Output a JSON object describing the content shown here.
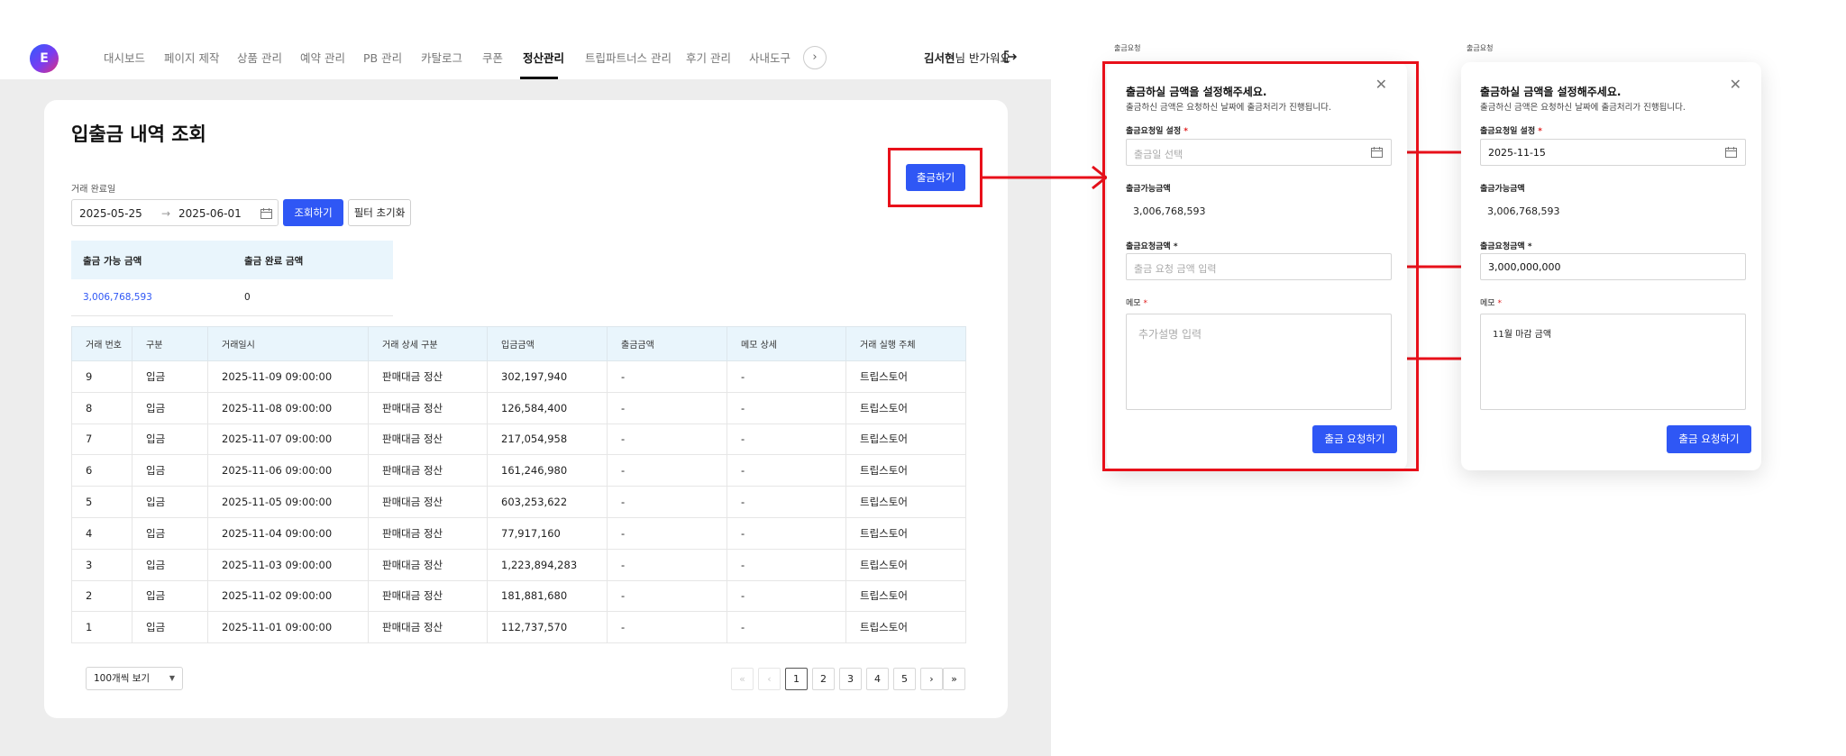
{
  "app": {
    "logo_letter": "E",
    "nav": [
      "대시보드",
      "페이지 제작",
      "상품 관리",
      "예약 관리",
      "PB 관리",
      "카탈로그",
      "쿠폰",
      "정산관리",
      "트립파트너스 관리",
      "후기 관리",
      "사내도구"
    ],
    "nav_active": "정산관리",
    "user_name": "김서현",
    "greeting_suffix": "님 반가워요"
  },
  "page": {
    "title": "입출금 내역 조회",
    "date_label": "거래 완료일",
    "date_from": "2025-05-25",
    "date_to": "2025-06-01",
    "search_button": "조회하기",
    "reset_button": "필터 초기화",
    "withdraw_button": "출금하기"
  },
  "summary": {
    "headers": [
      "출금 가능 금액",
      "출금 완료 금액"
    ],
    "values": [
      "3,006,768,593",
      "0"
    ]
  },
  "table": {
    "headers": [
      "거래 번호",
      "구분",
      "거래일시",
      "거래 상세 구분",
      "입금금액",
      "출금금액",
      "메모 상세",
      "거래 실행 주체"
    ],
    "rows": [
      [
        "9",
        "입금",
        "2025-11-09 09:00:00",
        "판매대금 정산",
        "302,197,940",
        "-",
        "-",
        "트립스토어"
      ],
      [
        "8",
        "입금",
        "2025-11-08 09:00:00",
        "판매대금 정산",
        "126,584,400",
        "-",
        "-",
        "트립스토어"
      ],
      [
        "7",
        "입금",
        "2025-11-07 09:00:00",
        "판매대금 정산",
        "217,054,958",
        "-",
        "-",
        "트립스토어"
      ],
      [
        "6",
        "입금",
        "2025-11-06 09:00:00",
        "판매대금 정산",
        "161,246,980",
        "-",
        "-",
        "트립스토어"
      ],
      [
        "5",
        "입금",
        "2025-11-05 09:00:00",
        "판매대금 정산",
        "603,253,622",
        "-",
        "-",
        "트립스토어"
      ],
      [
        "4",
        "입금",
        "2025-11-04 09:00:00",
        "판매대금 정산",
        "77,917,160",
        "-",
        "-",
        "트립스토어"
      ],
      [
        "3",
        "입금",
        "2025-11-03 09:00:00",
        "판매대금 정산",
        "1,223,894,283",
        "-",
        "-",
        "트립스토어"
      ],
      [
        "2",
        "입금",
        "2025-11-02 09:00:00",
        "판매대금 정산",
        "181,881,680",
        "-",
        "-",
        "트립스토어"
      ],
      [
        "1",
        "입금",
        "2025-11-01 09:00:00",
        "판매대금 정산",
        "112,737,570",
        "-",
        "-",
        "트립스토어"
      ]
    ]
  },
  "pagination": {
    "per_page": "100개씩 보기",
    "first": "«",
    "prev": "‹",
    "pages": [
      "1",
      "2",
      "3",
      "4",
      "5"
    ],
    "current": "1",
    "next": "›",
    "last": "»"
  },
  "modal_empty": {
    "caption": "출금요청",
    "title": "출금하실 금액을 설정해주세요.",
    "subtitle": "출금하신 금액은 요청하신 날짜에 출금처리가 진행됩니다.",
    "close": "✕",
    "date_label": "출금요청일 설정",
    "date_placeholder": "출금일 선택",
    "available_label": "출금가능금액",
    "available_value": "3,006,768,593",
    "amount_label": "출금요청금액",
    "amount_placeholder": "출금 요청 금액 입력",
    "memo_label": "메모",
    "memo_placeholder": "추가설명 입력",
    "submit": "출금 요청하기",
    "required_mark": "*"
  },
  "modal_filled": {
    "caption": "출금요청",
    "title": "출금하실 금액을 설정해주세요.",
    "subtitle": "출금하신 금액은 요청하신 날짜에 출금처리가 진행됩니다.",
    "close": "✕",
    "date_label": "출금요청일 설정",
    "date_value": "2025-11-15",
    "available_label": "출금가능금액",
    "available_value": "3,006,768,593",
    "amount_label": "출금요청금액",
    "amount_value": "3,000,000,000",
    "memo_label": "메모",
    "memo_value": "11월 마감 금액",
    "submit": "출금 요청하기",
    "required_mark": "*"
  },
  "colors": {
    "primary": "#2f57f5",
    "highlight": "#e8101a",
    "table_header_bg": "#e9f5fc",
    "link_value": "#2f57f5"
  }
}
